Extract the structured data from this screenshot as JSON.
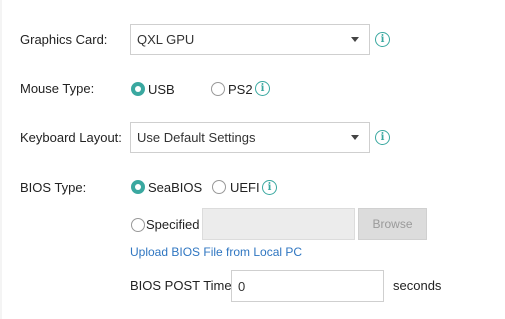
{
  "graphics_card": {
    "label": "Graphics Card:",
    "value": "QXL GPU"
  },
  "mouse_type": {
    "label": "Mouse Type:",
    "options": [
      "USB",
      "PS2"
    ],
    "selected": "USB"
  },
  "keyboard_layout": {
    "label": "Keyboard Layout:",
    "value": "Use Default Settings"
  },
  "bios_type": {
    "label": "BIOS Type:",
    "options": [
      "SeaBIOS",
      "UEFI",
      "Specified"
    ],
    "selected": "SeaBIOS",
    "browse_label": "Browse",
    "upload_link": "Upload BIOS File from Local PC"
  },
  "bios_post_time": {
    "label": "BIOS POST Time:",
    "value": "0",
    "unit": "seconds"
  },
  "colors": {
    "accent": "#3aa8a0",
    "link": "#2f76c1"
  },
  "icons": {
    "info": "info-icon",
    "dropdown": "chevron-down-icon"
  }
}
